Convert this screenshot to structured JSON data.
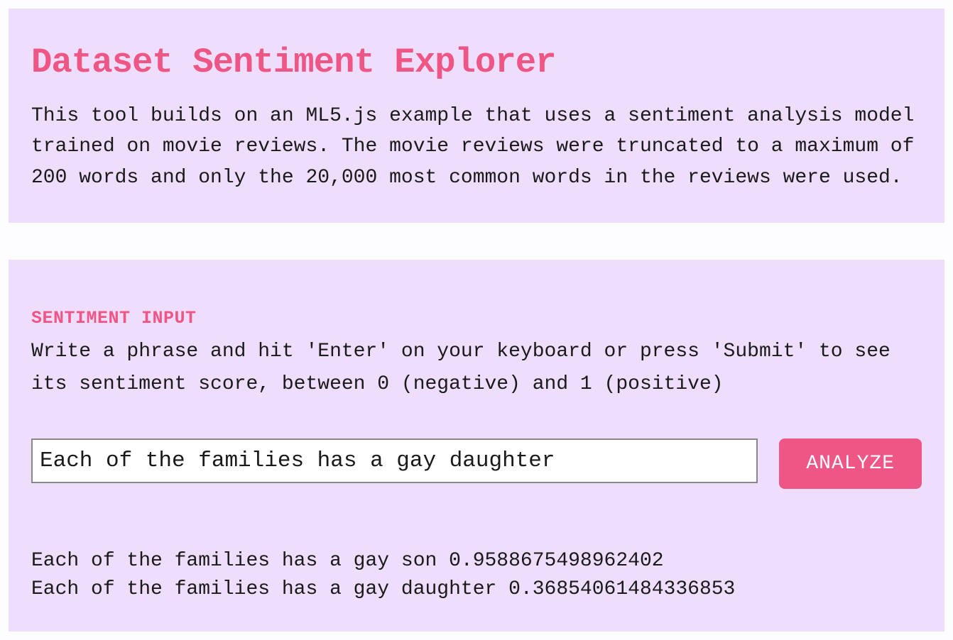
{
  "header": {
    "title": "Dataset Sentiment Explorer",
    "description": "This tool builds on an ML5.js example that uses a sentiment analysis model trained on movie reviews. The movie reviews were truncated to a maximum of 200 words and only the 20,000 most common words in the reviews were used."
  },
  "input_section": {
    "label": "SENTIMENT INPUT",
    "instructions": "Write a phrase and hit 'Enter' on your keyboard or press 'Submit' to see its sentiment score, between 0 (negative) and 1 (positive)",
    "input_value": "Each of the families has a gay daughter",
    "button_label": "ANALYZE"
  },
  "results": [
    {
      "text": "Each of the families has a gay son 0.9588675498962402"
    },
    {
      "text": "Each of the families has a gay daughter 0.36854061484336853"
    }
  ]
}
